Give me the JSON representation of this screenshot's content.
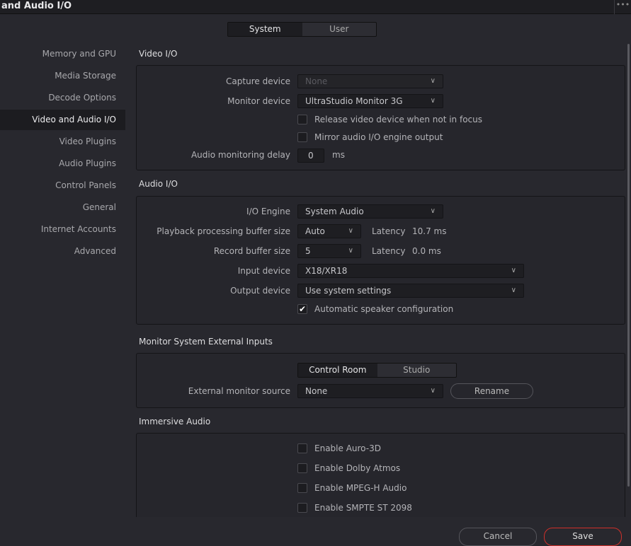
{
  "window": {
    "title": "and Audio I/O",
    "more_icon": "ellipsis-icon"
  },
  "tabs": [
    {
      "label": "System",
      "selected": true
    },
    {
      "label": "User",
      "selected": false
    }
  ],
  "sidebar": {
    "items": [
      "Memory and GPU",
      "Media Storage",
      "Decode Options",
      "Video and Audio I/O",
      "Video Plugins",
      "Audio Plugins",
      "Control Panels",
      "General",
      "Internet Accounts",
      "Advanced"
    ],
    "selected": "Video and Audio I/O"
  },
  "video_io": {
    "title": "Video I/O",
    "capture_label": "Capture device",
    "capture_value": "None",
    "monitor_label": "Monitor device",
    "monitor_value": "UltraStudio Monitor 3G",
    "release_label": "Release video device when not in focus",
    "release_checked": false,
    "mirror_label": "Mirror audio I/O engine output",
    "mirror_checked": false,
    "delay_label": "Audio monitoring delay",
    "delay_value": "0",
    "delay_unit": "ms"
  },
  "audio_io": {
    "title": "Audio I/O",
    "engine_label": "I/O Engine",
    "engine_value": "System Audio",
    "playback_label": "Playback processing buffer size",
    "playback_value": "Auto",
    "playback_latency_label": "Latency",
    "playback_latency": "10.7 ms",
    "record_label": "Record buffer size",
    "record_value": "5",
    "record_latency_label": "Latency",
    "record_latency": "0.0 ms",
    "input_label": "Input device",
    "input_value": "X18/XR18",
    "output_label": "Output device",
    "output_value": "Use system settings",
    "auto_speaker_label": "Automatic speaker configuration",
    "auto_speaker_checked": true
  },
  "monitor_ext": {
    "title": "Monitor System External Inputs",
    "tabs": [
      {
        "label": "Control Room",
        "selected": true
      },
      {
        "label": "Studio",
        "selected": false
      }
    ],
    "source_label": "External monitor source",
    "source_value": "None",
    "rename_label": "Rename"
  },
  "immersive": {
    "title": "Immersive Audio",
    "options": [
      {
        "label": "Enable Auro-3D",
        "checked": false
      },
      {
        "label": "Enable Dolby Atmos",
        "checked": false
      },
      {
        "label": "Enable MPEG-H Audio",
        "checked": false
      },
      {
        "label": "Enable SMPTE ST 2098",
        "checked": false
      }
    ]
  },
  "footer": {
    "cancel_label": "Cancel",
    "save_label": "Save",
    "save_accent": "#d0302a"
  }
}
